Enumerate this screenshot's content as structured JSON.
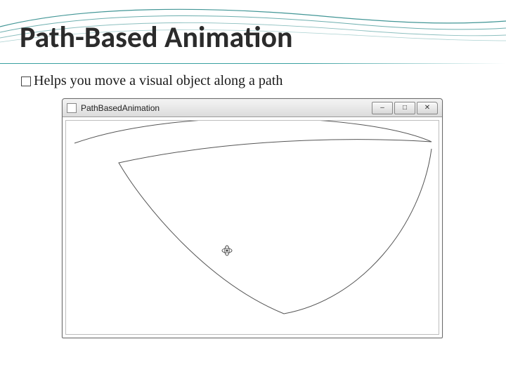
{
  "accent_color": "#2e8b8b",
  "title": "Path-Based Animation",
  "bullet_text": "Helps you move a visual object along a path",
  "window": {
    "title": "PathBasedAnimation",
    "buttons": {
      "minimize": "–",
      "maximize": "□",
      "close": "✕"
    }
  }
}
